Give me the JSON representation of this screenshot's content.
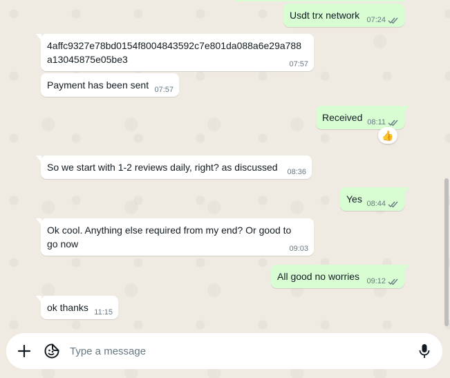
{
  "messages": [
    {
      "direction": "out",
      "text": "Usdt trx network",
      "time": "07:24",
      "status": "read"
    },
    {
      "direction": "in",
      "text": "4affc9327e78bd0154f8004843592c7e801da088a6e29a788a13045875e05be3",
      "time": "07:57"
    },
    {
      "direction": "in",
      "text": "Payment has been sent",
      "time": "07:57"
    },
    {
      "direction": "out",
      "text": "Received",
      "time": "08:11",
      "status": "read",
      "reaction": "👍"
    },
    {
      "direction": "in",
      "text": "So we start with 1-2 reviews daily, right? as discussed",
      "time": "08:36"
    },
    {
      "direction": "out",
      "text": "Yes",
      "time": "08:44",
      "status": "read"
    },
    {
      "direction": "in",
      "text": "Ok cool. Anything else required from my end? Or good to go now",
      "time": "09:03"
    },
    {
      "direction": "out",
      "text": "All good no worries",
      "time": "09:12",
      "status": "read"
    },
    {
      "direction": "in",
      "text": "ok thanks",
      "time": "11:15"
    }
  ],
  "composer": {
    "placeholder": "Type a message",
    "attach_icon": "plus-icon",
    "sticker_icon": "sticker-icon",
    "mic_icon": "microphone-icon"
  },
  "colors": {
    "incoming_bubble": "#ffffff",
    "outgoing_bubble": "#d9fdd3",
    "background": "#efeae2",
    "read_tick": "#667781"
  }
}
